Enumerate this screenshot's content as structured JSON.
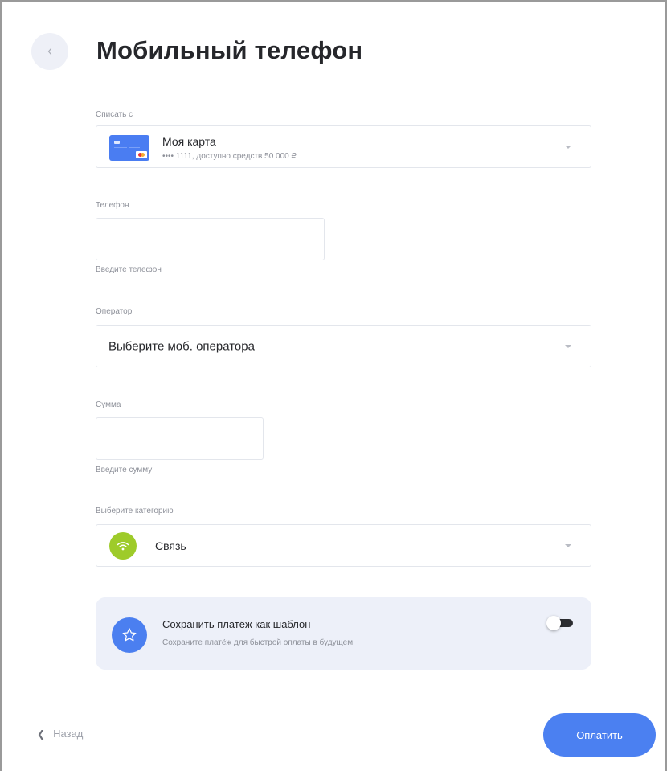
{
  "header": {
    "title": "Мобильный телефон"
  },
  "source": {
    "label": "Списать с",
    "card_name": "Моя карта",
    "card_details": "•••• 1111, доступно средств 50 000 ₽"
  },
  "phone": {
    "label": "Телефон",
    "value": "",
    "hint": "Введите телефон"
  },
  "operator": {
    "label": "Оператор",
    "selected": "Выберите моб. оператора"
  },
  "amount": {
    "label": "Сумма",
    "value": "",
    "hint": "Введите сумму"
  },
  "category": {
    "label": "Выберите категорию",
    "selected": "Связь",
    "icon": "wifi-icon",
    "icon_color": "#9ecb2a"
  },
  "template": {
    "title": "Сохранить платёж как шаблон",
    "subtitle": "Сохраните платёж для быстрой оплаты в будущем.",
    "icon": "star-icon",
    "enabled": false
  },
  "footer": {
    "back_label": "Назад",
    "pay_label": "Оплатить"
  },
  "colors": {
    "accent": "#4b80f1",
    "muted_text": "#8d9099",
    "panel_bg": "#edf0f9"
  }
}
